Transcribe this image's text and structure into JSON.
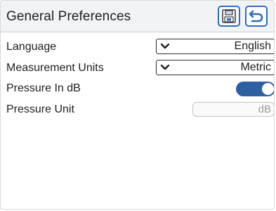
{
  "header": {
    "title": "General Preferences",
    "save_icon": "save-icon",
    "back_icon": "back-arrow-icon",
    "accent_color": "#2b6cc4"
  },
  "settings": {
    "language": {
      "label": "Language",
      "value": "English"
    },
    "measurement_units": {
      "label": "Measurement Units",
      "value": "Metric"
    },
    "pressure_in_db": {
      "label": "Pressure In dB",
      "state": "on"
    },
    "pressure_unit": {
      "label": "Pressure Unit",
      "value": "dB"
    }
  },
  "colors": {
    "toggle_on": "#2d5fa3",
    "header_bg": "#f2f3f5"
  }
}
